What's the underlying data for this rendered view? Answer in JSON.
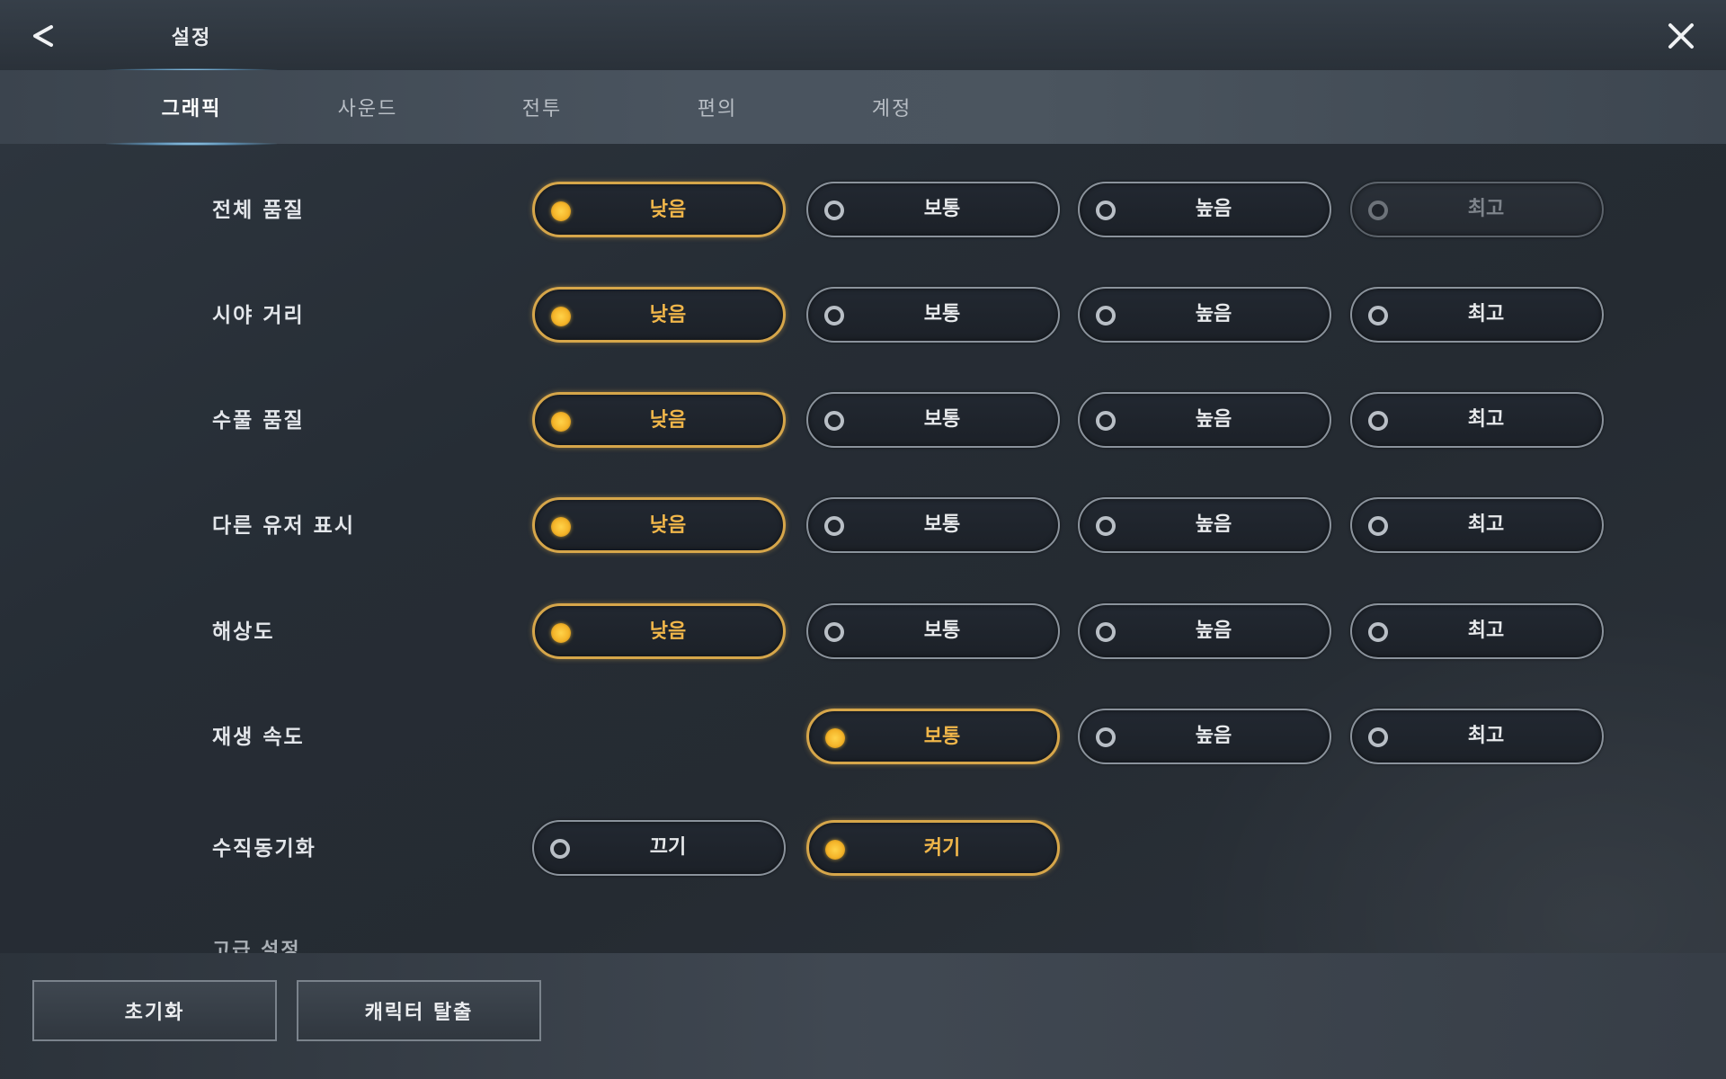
{
  "header": {
    "title": "설정",
    "back_icon": "chevron-left-icon",
    "close_icon": "close-icon"
  },
  "tabs": [
    {
      "label": "그래픽",
      "active": true
    },
    {
      "label": "사운드",
      "active": false
    },
    {
      "label": "전투",
      "active": false
    },
    {
      "label": "편의",
      "active": false
    },
    {
      "label": "계정",
      "active": false
    }
  ],
  "settings": [
    {
      "label": "전체 품질",
      "options": [
        {
          "label": "낮음",
          "selected": true
        },
        {
          "label": "보통",
          "selected": false
        },
        {
          "label": "높음",
          "selected": false
        },
        {
          "label": "최고",
          "selected": false,
          "disabled": true
        }
      ]
    },
    {
      "label": "시야 거리",
      "options": [
        {
          "label": "낮음",
          "selected": true
        },
        {
          "label": "보통",
          "selected": false
        },
        {
          "label": "높음",
          "selected": false
        },
        {
          "label": "최고",
          "selected": false
        }
      ]
    },
    {
      "label": "수풀 품질",
      "options": [
        {
          "label": "낮음",
          "selected": true
        },
        {
          "label": "보통",
          "selected": false
        },
        {
          "label": "높음",
          "selected": false
        },
        {
          "label": "최고",
          "selected": false
        }
      ]
    },
    {
      "label": "다른 유저 표시",
      "options": [
        {
          "label": "낮음",
          "selected": true
        },
        {
          "label": "보통",
          "selected": false
        },
        {
          "label": "높음",
          "selected": false
        },
        {
          "label": "최고",
          "selected": false
        }
      ]
    },
    {
      "label": "해상도",
      "options": [
        {
          "label": "낮음",
          "selected": true
        },
        {
          "label": "보통",
          "selected": false
        },
        {
          "label": "높음",
          "selected": false
        },
        {
          "label": "최고",
          "selected": false
        }
      ]
    },
    {
      "label": "재생 속도",
      "options": [
        {
          "label": "보통",
          "selected": true
        },
        {
          "label": "높음",
          "selected": false
        },
        {
          "label": "최고",
          "selected": false
        }
      ]
    },
    {
      "label": "수직동기화",
      "options": [
        {
          "label": "끄기",
          "selected": false
        },
        {
          "label": "켜기",
          "selected": true
        }
      ]
    }
  ],
  "next_section_label": "고급 설정",
  "footer": {
    "reset_label": "초기화",
    "exit_character_label": "캐릭터 탈출"
  },
  "colors": {
    "accent": "#d6a64a",
    "radio_selected": "#f5b52a",
    "tab_glow": "#aae1ff"
  }
}
